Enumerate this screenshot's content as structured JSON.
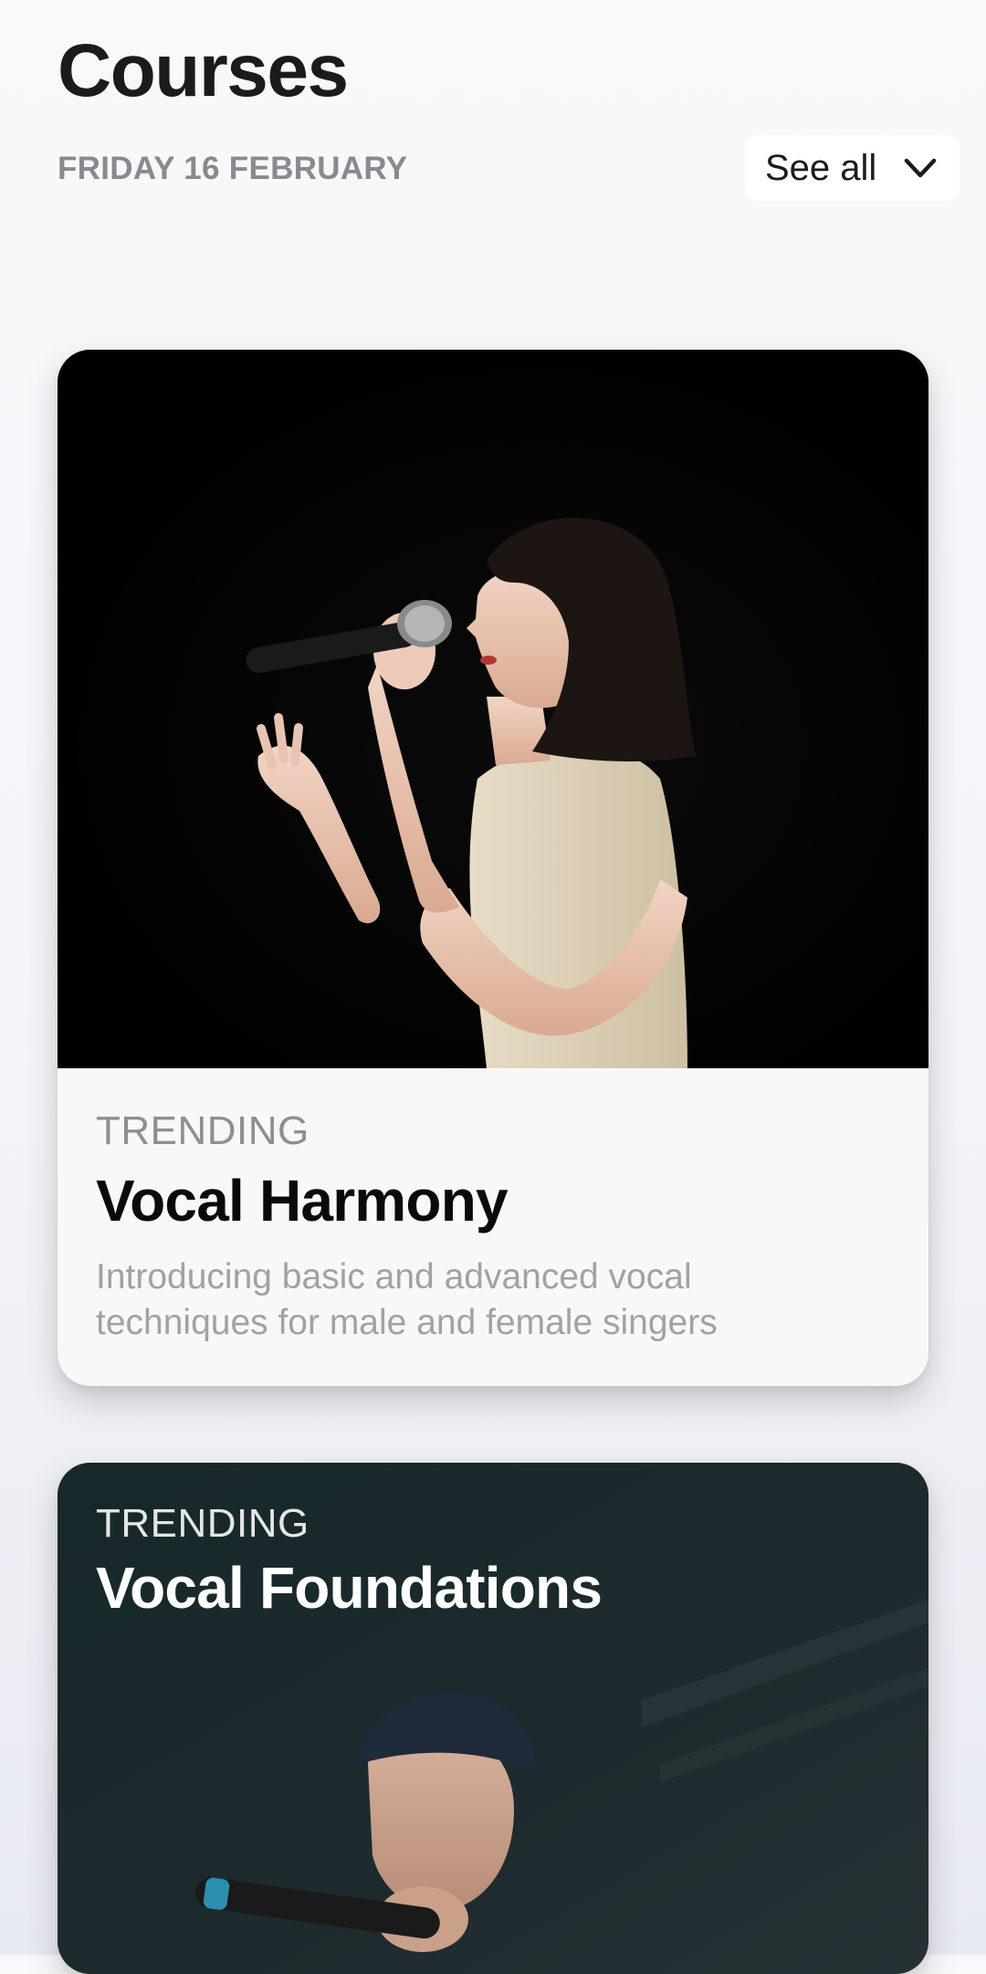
{
  "header": {
    "title": "Courses",
    "date": "FRIDAY 16 FEBRUARY",
    "see_all_label": "See all"
  },
  "cards": [
    {
      "eyebrow": "TRENDING",
      "title": "Vocal Harmony",
      "description": "Introducing basic and advanced vocal techniques for male and female singers",
      "image": "woman-singing-with-microphone-photo"
    },
    {
      "eyebrow": "TRENDING",
      "title": "Vocal Foundations",
      "image": "man-in-beanie-singing-photo"
    }
  ],
  "colors": {
    "title": "#1b1b1d",
    "muted": "#8a8a8e",
    "card_bg": "#f8f8f9",
    "dark_card_bg": "#1c2526"
  }
}
